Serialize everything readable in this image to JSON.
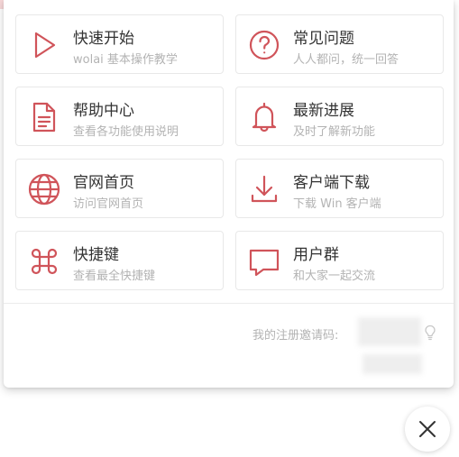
{
  "colors": {
    "accent": "#d0545a",
    "title_text": "#333333",
    "desc_text": "#b3b3b3",
    "border": "#e8e8e8"
  },
  "cards": [
    {
      "title": "快速开始",
      "desc": "wolai 基本操作教学",
      "icon": "play-icon"
    },
    {
      "title": "常见问题",
      "desc": "人人都问，统一回答",
      "icon": "question-icon"
    },
    {
      "title": "帮助中心",
      "desc": "查看各功能使用说明",
      "icon": "document-icon"
    },
    {
      "title": "最新进展",
      "desc": "及时了解新功能",
      "icon": "bell-icon"
    },
    {
      "title": "官网首页",
      "desc": "访问官网首页",
      "icon": "globe-icon"
    },
    {
      "title": "客户端下载",
      "desc": "下载 Win 客户端",
      "icon": "download-icon"
    },
    {
      "title": "快捷键",
      "desc": "查看最全快捷键",
      "icon": "command-icon"
    },
    {
      "title": "用户群",
      "desc": "和大家一起交流",
      "icon": "chat-bubble-icon"
    }
  ],
  "footer": {
    "invite_label": "我的注册邀请码:"
  },
  "close_button": {
    "icon": "close-icon"
  }
}
